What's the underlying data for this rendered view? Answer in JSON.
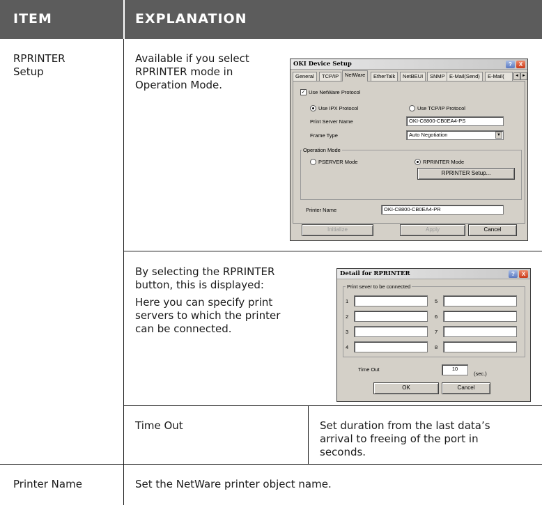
{
  "table": {
    "header": {
      "item": "ITEM",
      "explanation": "EXPLANATION"
    },
    "rows": {
      "rprinter": {
        "item_lines": [
          "RPRINTER",
          "Setup"
        ],
        "desc_lines": [
          "Available if you select",
          "RPRINTER mode in",
          "Operation Mode."
        ],
        "detail_lines_1": [
          "By selecting the RPRINTER",
          "button, this is displayed:"
        ],
        "detail_lines_2": [
          "Here you can specify print",
          "servers to which the printer",
          "can be connected."
        ],
        "timeout_label": "Time Out",
        "timeout_desc_lines": [
          "Set duration from the last data’s",
          "arrival to freeing of the port in",
          "seconds."
        ]
      },
      "printer_name": {
        "item": "Printer Name",
        "desc": "Set the NetWare printer object name."
      }
    }
  },
  "setup_dialog": {
    "title": "OKI Device Setup",
    "help": "?",
    "close": "X",
    "tabs": [
      "General",
      "TCP/IP",
      "NetWare",
      "EtherTalk",
      "NetBEUI",
      "SNMP",
      "E-Mail(Send)",
      "E-Mail("
    ],
    "active_tab": "NetWare",
    "tab_prev": "◄",
    "tab_next": "►",
    "use_netware": {
      "label": "Use NetWare Protocol",
      "checked": true,
      "mark": "✓"
    },
    "use_ipx": "Use IPX Protocol",
    "use_tcpip": "Use TCP/IP Protocol",
    "print_server_name": {
      "label": "Print Server Name",
      "value": "OKI-C8800-CB0EA4-PS"
    },
    "frame_type": {
      "label": "Frame Type",
      "value": "Auto Negotiation",
      "arrow": "▼"
    },
    "operation_mode": {
      "title": "Operation Mode",
      "pserver": "PSERVER Mode",
      "rprinter": "RPRINTER Mode",
      "rprinter_setup_button": "RPRINTER Setup..."
    },
    "printer_name": {
      "label": "Printer Name",
      "value": "OKI-C8800-CB0EA4-PR"
    },
    "buttons": {
      "initialize": "Initialize",
      "apply": "Apply",
      "cancel": "Cancel"
    }
  },
  "detail_dialog": {
    "title": "Detail for RPRINTER",
    "help": "?",
    "close": "X",
    "group_title": "Print sever to be connected",
    "left_numbers": [
      "1",
      "2",
      "3",
      "4"
    ],
    "right_numbers": [
      "5",
      "6",
      "7",
      "8"
    ],
    "timeout": {
      "label": "Time Out",
      "value": "10",
      "unit": "(sec.)"
    },
    "buttons": {
      "ok": "OK",
      "cancel": "Cancel"
    }
  }
}
